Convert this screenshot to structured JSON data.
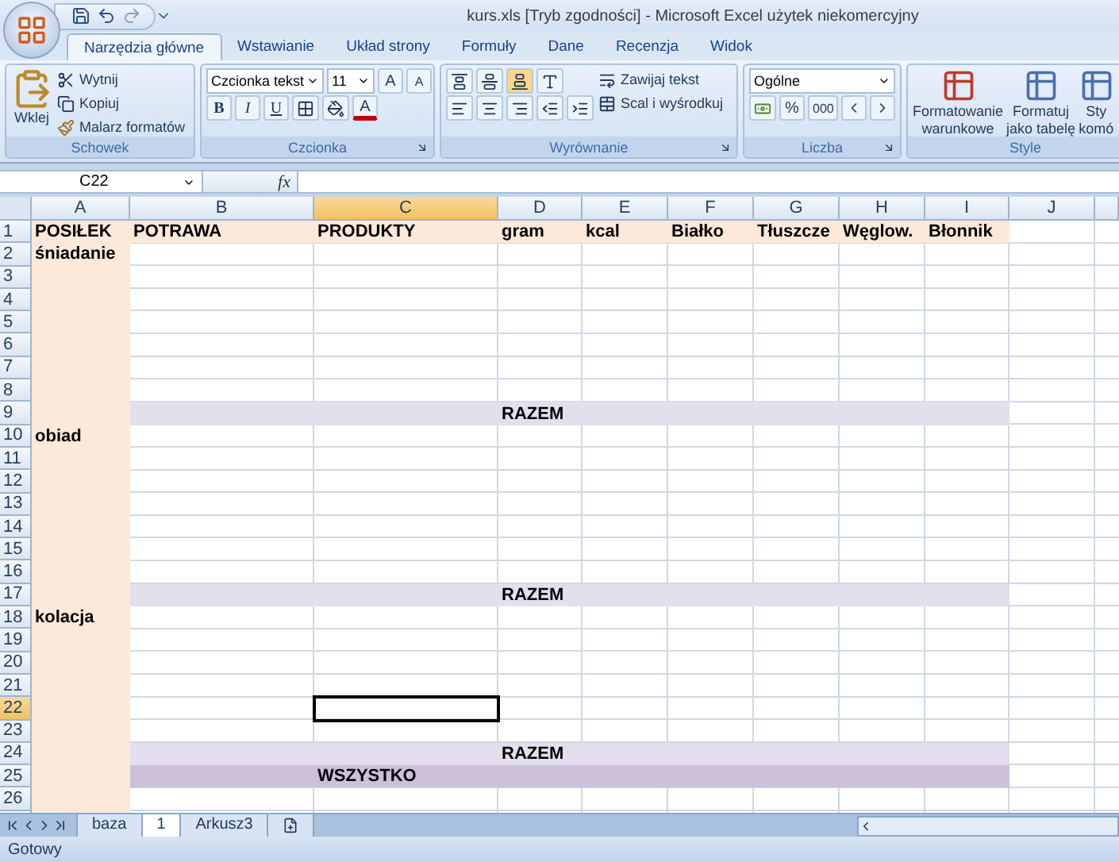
{
  "window": {
    "title": "kurs.xls  [Tryb zgodności] - Microsoft Excel użytek niekomercyjny"
  },
  "tabs": [
    {
      "label": "Narzędzia główne",
      "selected": true
    },
    {
      "label": "Wstawianie",
      "selected": false
    },
    {
      "label": "Układ strony",
      "selected": false
    },
    {
      "label": "Formuły",
      "selected": false
    },
    {
      "label": "Dane",
      "selected": false
    },
    {
      "label": "Recenzja",
      "selected": false
    },
    {
      "label": "Widok",
      "selected": false
    }
  ],
  "ribbon": {
    "clipboard": {
      "label": "Schowek",
      "paste": "Wklej",
      "cut": "Wytnij",
      "copy": "Kopiuj",
      "painter": "Malarz formatów"
    },
    "font": {
      "label": "Czcionka",
      "name": "Czcionka tekst",
      "size": "11",
      "grow": "A",
      "shrink": "A",
      "bold": "B",
      "italic": "I",
      "underline": "U",
      "font_color_letter": "A"
    },
    "alignment": {
      "label": "Wyrównanie",
      "wrap": "Zawijaj tekst",
      "merge": "Scal i wyśrodkuj"
    },
    "number": {
      "label": "Liczba",
      "format": "Ogólne",
      "percent": "%",
      "thousands": "000"
    },
    "styles": {
      "label": "Style",
      "conditional": [
        "Formatowanie",
        "warunkowe"
      ],
      "table": [
        "Formatuj",
        "jako tabelę"
      ],
      "cell": [
        "Sty",
        "komó"
      ]
    }
  },
  "formula_bar": {
    "name_box": "C22",
    "fx": "fx"
  },
  "columns": [
    {
      "label": "A",
      "selected": false
    },
    {
      "label": "B",
      "selected": false
    },
    {
      "label": "C",
      "selected": true
    },
    {
      "label": "D",
      "selected": false
    },
    {
      "label": "E",
      "selected": false
    },
    {
      "label": "F",
      "selected": false
    },
    {
      "label": "G",
      "selected": false
    },
    {
      "label": "H",
      "selected": false
    },
    {
      "label": "I",
      "selected": false
    },
    {
      "label": "J",
      "selected": false
    }
  ],
  "rows": [
    {
      "label": "1",
      "kind": "header",
      "selected": false,
      "cells": {
        "A": "POSIŁEK",
        "B": "POTRAWA",
        "C": "PRODUKTY",
        "D": "gram",
        "E": "kcal",
        "F": "Białko",
        "G": "Tłuszcze",
        "H": "Węglow.",
        "I": "Błonnik"
      }
    },
    {
      "label": "2",
      "kind": "plain",
      "selected": false,
      "cells": {
        "A": "śniadanie"
      }
    },
    {
      "label": "3",
      "kind": "plain",
      "selected": false
    },
    {
      "label": "4",
      "kind": "plain",
      "selected": false
    },
    {
      "label": "5",
      "kind": "plain",
      "selected": false
    },
    {
      "label": "6",
      "kind": "plain",
      "selected": false
    },
    {
      "label": "7",
      "kind": "plain",
      "selected": false
    },
    {
      "label": "8",
      "kind": "plain",
      "selected": false
    },
    {
      "label": "9",
      "kind": "subtotal",
      "selected": false,
      "cells": {
        "D": "RAZEM"
      }
    },
    {
      "label": "10",
      "kind": "plain",
      "selected": false,
      "cells": {
        "A": "obiad"
      }
    },
    {
      "label": "11",
      "kind": "plain",
      "selected": false
    },
    {
      "label": "12",
      "kind": "plain",
      "selected": false
    },
    {
      "label": "13",
      "kind": "plain",
      "selected": false
    },
    {
      "label": "14",
      "kind": "plain",
      "selected": false
    },
    {
      "label": "15",
      "kind": "plain",
      "selected": false
    },
    {
      "label": "16",
      "kind": "plain",
      "selected": false
    },
    {
      "label": "17",
      "kind": "subtotal",
      "selected": false,
      "cells": {
        "D": "RAZEM"
      }
    },
    {
      "label": "18",
      "kind": "plain",
      "selected": false,
      "cells": {
        "A": "kolacja"
      }
    },
    {
      "label": "19",
      "kind": "plain",
      "selected": false
    },
    {
      "label": "20",
      "kind": "plain",
      "selected": false
    },
    {
      "label": "21",
      "kind": "plain",
      "selected": false
    },
    {
      "label": "22",
      "kind": "plain",
      "selected": true
    },
    {
      "label": "23",
      "kind": "plain",
      "selected": false
    },
    {
      "label": "24",
      "kind": "subtotal",
      "selected": false,
      "cells": {
        "D": "RAZEM"
      }
    },
    {
      "label": "25",
      "kind": "total",
      "selected": false,
      "cells": {
        "C": "WSZYSTKO"
      }
    },
    {
      "label": "26",
      "kind": "plain",
      "selected": false
    }
  ],
  "sheets": [
    {
      "label": "baza",
      "selected": false
    },
    {
      "label": "1",
      "selected": true
    },
    {
      "label": "Arkusz3",
      "selected": false
    }
  ],
  "status_bar": {
    "text": "Gotowy"
  }
}
